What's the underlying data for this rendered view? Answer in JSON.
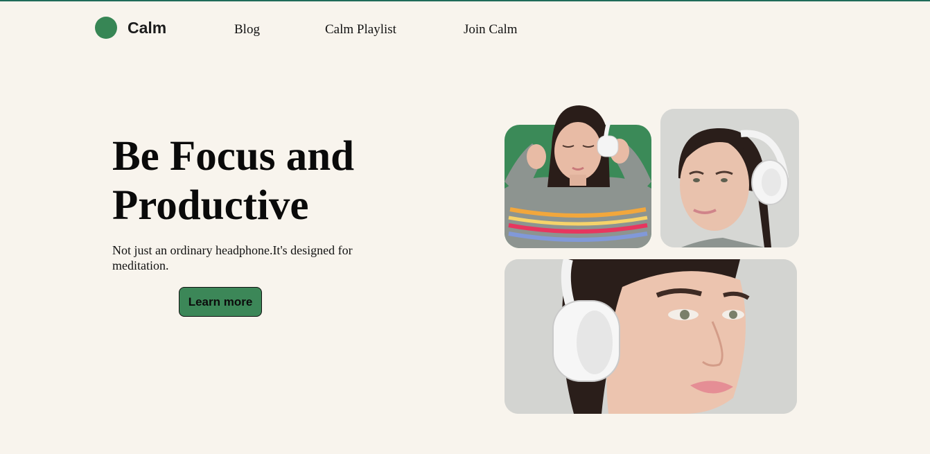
{
  "nav": {
    "brand": "Calm",
    "links": [
      "Blog",
      "Calm Playlist",
      "Join Calm"
    ]
  },
  "hero": {
    "title": "Be Focus and Productive",
    "subtitle": "Not just an ordinary headphone.It's designed for meditation.",
    "cta_label": "Learn more"
  },
  "colors": {
    "background": "#f8f4ed",
    "brand_green": "#378655",
    "top_border": "#1f6b5a"
  },
  "images": [
    {
      "name": "woman-headphones-green-bg"
    },
    {
      "name": "woman-headphones-portrait"
    },
    {
      "name": "woman-headphones-closeup"
    }
  ]
}
